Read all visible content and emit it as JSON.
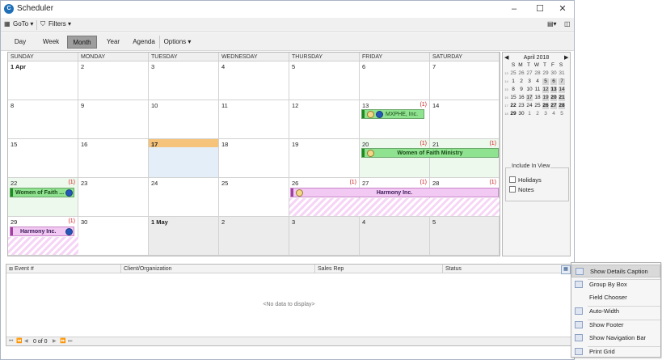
{
  "window": {
    "title": "Scheduler",
    "app_icon": "scheduler-logo"
  },
  "toolbar": {
    "goto_label": "GoTo",
    "filters_label": "Filters"
  },
  "views": {
    "items": [
      "Day",
      "Week",
      "Month",
      "Year",
      "Agenda"
    ],
    "active": "Month",
    "options_label": "Options"
  },
  "calendar": {
    "day_headers": [
      "SUNDAY",
      "MONDAY",
      "TUESDAY",
      "WEDNESDAY",
      "THURSDAY",
      "FRIDAY",
      "SATURDAY"
    ],
    "weeks": [
      [
        "1 Apr",
        "2",
        "3",
        "4",
        "5",
        "6",
        "7"
      ],
      [
        "8",
        "9",
        "10",
        "11",
        "12",
        "13",
        "14"
      ],
      [
        "15",
        "16",
        "17",
        "18",
        "19",
        "20",
        "21"
      ],
      [
        "22",
        "23",
        "24",
        "25",
        "26",
        "27",
        "28"
      ],
      [
        "29",
        "30",
        "1 May",
        "2",
        "3",
        "4",
        "5"
      ]
    ],
    "more_indicator": "(1)",
    "appointments": {
      "mxphe": "MXPHE, Inc.",
      "wofm": "Women of Faith Ministry",
      "wofm_short": "Women of Faith ...",
      "harmony": "Harmony Inc."
    },
    "accent": "#8fe28f",
    "harmony_color": "#f2c9f2",
    "today_color": "#f5c37a"
  },
  "mini_calendar": {
    "title": "April 2018",
    "prev_icon": "triangle-left-icon",
    "next_icon": "triangle-right-icon",
    "day_letters": [
      "S",
      "M",
      "T",
      "W",
      "T",
      "F",
      "S"
    ],
    "week_numbers": [
      "13",
      "14",
      "15",
      "16",
      "17",
      "18"
    ],
    "rows": [
      [
        "25",
        "26",
        "27",
        "28",
        "29",
        "30",
        "31"
      ],
      [
        "1",
        "2",
        "3",
        "4",
        "5",
        "6",
        "7"
      ],
      [
        "8",
        "9",
        "10",
        "11",
        "12",
        "13",
        "14"
      ],
      [
        "15",
        "16",
        "17",
        "18",
        "19",
        "20",
        "21"
      ],
      [
        "22",
        "23",
        "24",
        "25",
        "26",
        "27",
        "28"
      ],
      [
        "29",
        "30",
        "1",
        "2",
        "3",
        "4",
        "5"
      ]
    ]
  },
  "include_in_view": {
    "title": "Include In View",
    "holidays": "Holidays",
    "notes": "Notes"
  },
  "grid": {
    "columns": [
      "Event #",
      "Client/Organization",
      "Sales Rep",
      "Status"
    ],
    "empty_text": "<No data to display>",
    "pager": "0 of 0"
  },
  "context_menu": {
    "items": [
      "Show Details Caption",
      "Group By Box",
      "Field Chooser",
      "Auto-Width",
      "Show Footer",
      "Show Navigation Bar",
      "Print Grid"
    ],
    "highlighted": "Show Details Caption"
  }
}
